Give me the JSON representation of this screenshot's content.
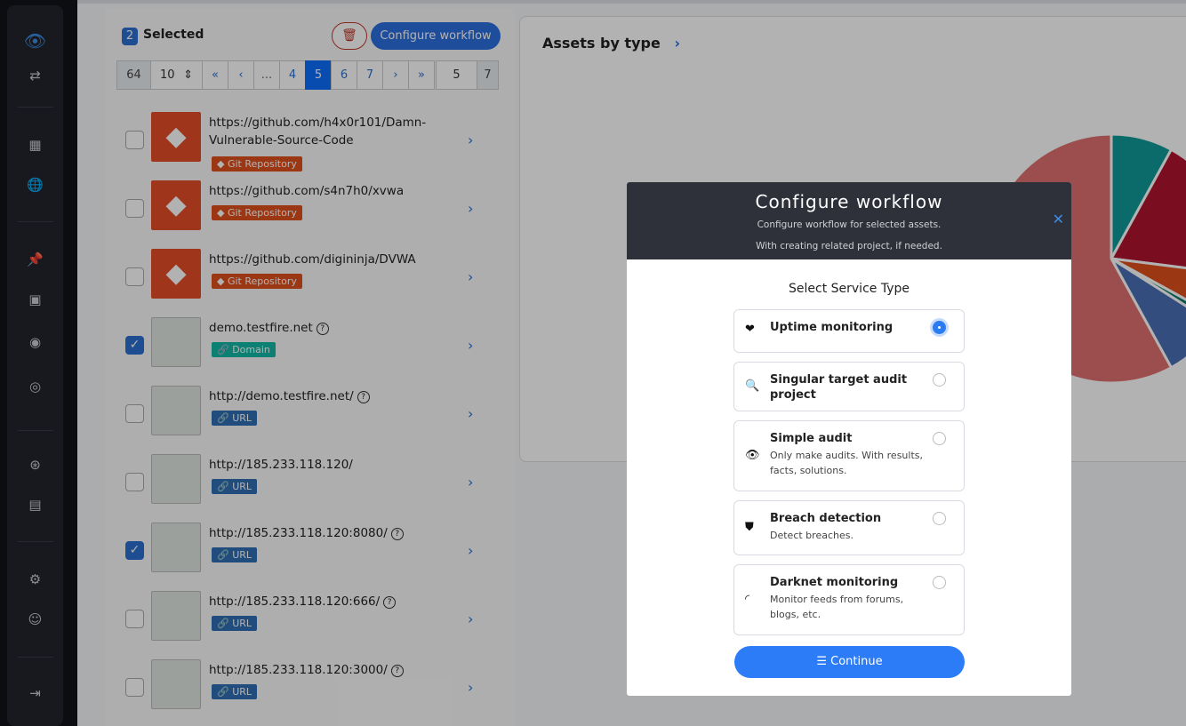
{
  "sidebar": {
    "icons": [
      "logo-eye-icon",
      "switch-icon",
      "dashboard-icon",
      "globe-icon",
      "pin-icon",
      "app-icon-1",
      "app-icon-2",
      "app-icon-3",
      "support-icon",
      "book-icon",
      "user-settings-icon",
      "agent-icon",
      "logout-icon"
    ]
  },
  "toolbar": {
    "selected_count": "2",
    "selected_label": "Selected",
    "configure_label": "Configure workflow"
  },
  "pager": {
    "total": "64",
    "per_page": "10",
    "first": "«",
    "prev": "‹",
    "ellipsis": "...",
    "pages": [
      "4",
      "5",
      "6",
      "7"
    ],
    "current": "5",
    "next": "›",
    "last": "»",
    "goto": "5",
    "page_count": "7"
  },
  "assets": [
    {
      "title": "https://github.com/h4x0r101/Damn-Vulnerable-Source-Code",
      "tag": "Git Repository",
      "type": "git",
      "checked": false,
      "help": false
    },
    {
      "title": "https://github.com/s4n7h0/xvwa",
      "tag": "Git Repository",
      "type": "git",
      "checked": false,
      "help": false
    },
    {
      "title": "https://github.com/digininja/DVWA",
      "tag": "Git Repository",
      "type": "git",
      "checked": false,
      "help": false
    },
    {
      "title": "demo.testfire.net",
      "tag": "Domain",
      "type": "domain",
      "checked": true,
      "help": true
    },
    {
      "title": "http://demo.testfire.net/",
      "tag": "URL",
      "type": "url",
      "checked": false,
      "help": true
    },
    {
      "title": "http://185.233.118.120/",
      "tag": "URL",
      "type": "url",
      "checked": false,
      "help": false
    },
    {
      "title": "http://185.233.118.120:8080/",
      "tag": "URL",
      "type": "url",
      "checked": true,
      "help": true
    },
    {
      "title": "http://185.233.118.120:666/",
      "tag": "URL",
      "type": "url",
      "checked": false,
      "help": true
    },
    {
      "title": "http://185.233.118.120:3000/",
      "tag": "URL",
      "type": "url",
      "checked": false,
      "help": true
    }
  ],
  "colors": {
    "git": "#e0501e",
    "domain": "#14b8a6",
    "url": "#2f6fb5",
    "accent": "#2b7cf6"
  },
  "card": {
    "title": "Assets by type"
  },
  "chart_data": {
    "type": "pie",
    "slices": [
      {
        "color": "#0f9a98",
        "value": 8
      },
      {
        "color": "#b0132e",
        "value": 19
      },
      {
        "color": "#e0501e",
        "value": 6
      },
      {
        "color": "#0d7a6c",
        "value": 1
      },
      {
        "color": "#4a6fb5",
        "value": 8
      },
      {
        "color": "#e07070",
        "value": 58
      }
    ]
  },
  "modal": {
    "title": "Configure workflow",
    "subtitle1": "Configure workflow for selected assets.",
    "subtitle2": "With creating related project, if needed.",
    "section": "Select Service Type",
    "continue_label": "Continue",
    "options": [
      {
        "name": "Uptime monitoring",
        "desc": "",
        "icon": "heart-pulse-icon",
        "selected": true
      },
      {
        "name": "Singular target audit project",
        "desc": "",
        "icon": "search-icon",
        "selected": false
      },
      {
        "name": "Simple audit",
        "desc": "Only make audits. With results, facts, solutions.",
        "icon": "eye-icon",
        "selected": false
      },
      {
        "name": "Breach detection",
        "desc": "Detect breaches.",
        "icon": "shield-icon",
        "selected": false
      },
      {
        "name": "Darknet monitoring",
        "desc": "Monitor feeds from forums, blogs, etc.",
        "icon": "rss-icon",
        "selected": false
      }
    ]
  }
}
